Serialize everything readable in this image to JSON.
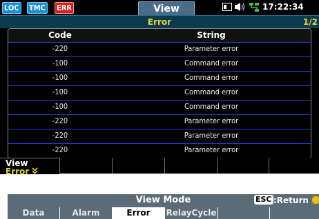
{
  "status": {
    "loc": "LOC",
    "tmc": "TMC",
    "err": "ERR",
    "view_title": "View",
    "time": "17:22:34"
  },
  "subheader": {
    "title": "Error",
    "page": "1/2"
  },
  "table": {
    "headers": [
      "Code",
      "String"
    ],
    "rows": [
      {
        "code": "-220",
        "string": "Parameter error"
      },
      {
        "code": "-100",
        "string": "Command error"
      },
      {
        "code": "-100",
        "string": "Command error"
      },
      {
        "code": "-100",
        "string": "Command error"
      },
      {
        "code": "-100",
        "string": "Command error"
      },
      {
        "code": "-220",
        "string": "Parameter error"
      },
      {
        "code": "-220",
        "string": "Parameter error"
      },
      {
        "code": "-220",
        "string": "Parameter error"
      }
    ]
  },
  "softkey": {
    "label": "View",
    "value": "Error"
  },
  "view_mode": {
    "title": "View Mode",
    "esc": "ESC",
    "return_label": ":Return",
    "modes": [
      "Data",
      "Alarm",
      "Error",
      "RelayCycle"
    ],
    "active_mode": "Error"
  },
  "colors": {
    "accent_yellow": "#e6d23a",
    "row_divider": "#1d3fe0",
    "err_red": "#d81a1a",
    "loc_blue": "#1a8fd8"
  }
}
